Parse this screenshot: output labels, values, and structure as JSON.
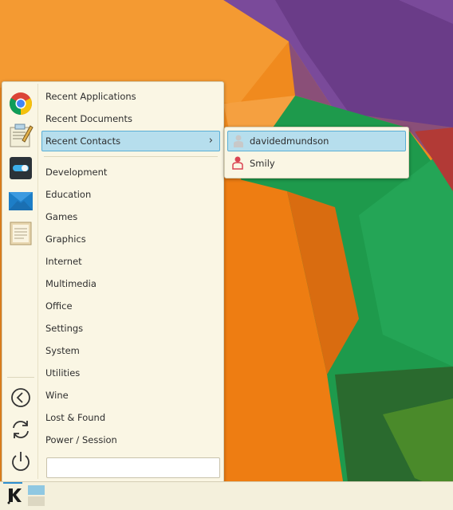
{
  "menu": {
    "favorites": [
      {
        "icon": "chrome-icon"
      },
      {
        "icon": "text-editor-icon"
      },
      {
        "icon": "system-settings-toggle-icon"
      },
      {
        "icon": "mail-icon"
      },
      {
        "icon": "document-viewer-icon"
      }
    ],
    "system_actions": [
      {
        "icon": "back-arrow-icon"
      },
      {
        "icon": "refresh-icon"
      },
      {
        "icon": "power-icon"
      }
    ],
    "items": [
      {
        "label": "Recent Applications"
      },
      {
        "label": "Recent Documents"
      },
      {
        "label": "Recent Contacts",
        "has_submenu": true,
        "selected": true
      },
      {
        "label": "Development"
      },
      {
        "label": "Education"
      },
      {
        "label": "Games"
      },
      {
        "label": "Graphics"
      },
      {
        "label": "Internet"
      },
      {
        "label": "Multimedia"
      },
      {
        "label": "Office"
      },
      {
        "label": "Settings"
      },
      {
        "label": "System"
      },
      {
        "label": "Utilities"
      },
      {
        "label": "Wine"
      },
      {
        "label": "Lost & Found"
      },
      {
        "label": "Power / Session"
      }
    ],
    "search_placeholder": ""
  },
  "submenu": {
    "items": [
      {
        "label": "davidedmundson",
        "icon": "user-grey-icon",
        "selected": true
      },
      {
        "label": "Smily",
        "icon": "user-red-icon"
      }
    ]
  },
  "colors": {
    "accent": "#b6deed",
    "accent_border": "#5aaed6",
    "panel": "#faf6e4"
  }
}
